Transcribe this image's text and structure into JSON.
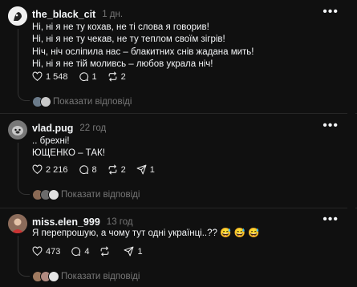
{
  "comments": [
    {
      "username": "the_black_cit",
      "time": "1 дн.",
      "lines": [
        "Ні, ні я не ту кохав, не ті слова я говорив!",
        "Ні, ні я не ту чекав, не ту теплом своїм зігрів!",
        "Ніч, ніч осліпила нас – блакитних снів жадана мить!",
        "Ні, ні я не тій моливсь – любов украла ніч!"
      ],
      "likes": "1 548",
      "comments_count": "1",
      "reposts": "2",
      "shares": "",
      "replies_label": "Показати відповіді"
    },
    {
      "username": "vlad.pug",
      "time": "22 год",
      "lines": [
        ".. брехні!",
        "ЮЩЕНКО – ТАК!"
      ],
      "likes": "2 216",
      "comments_count": "8",
      "reposts": "2",
      "shares": "1",
      "replies_label": "Показати відповіді"
    },
    {
      "username": "miss.elen_999",
      "time": "13 год",
      "lines": [
        "Я перепрошую, а чому тут одні українці..?? 😅 😅 😅"
      ],
      "likes": "473",
      "comments_count": "4",
      "reposts": "",
      "shares": "1",
      "replies_label": "Показати відповіді"
    }
  ],
  "icons": {
    "like": "heart-icon",
    "comment": "comment-bubble-icon",
    "repost": "repost-icon",
    "share": "share-icon",
    "more": "more-horizontal-icon"
  },
  "colors": {
    "background": "#101010",
    "text": "#f3f5f7",
    "muted": "#777777"
  }
}
